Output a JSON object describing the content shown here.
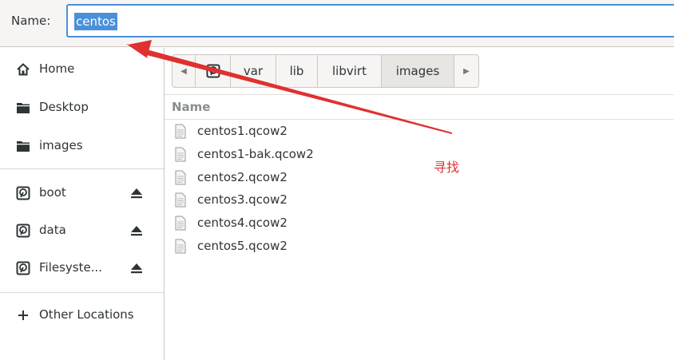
{
  "name_bar": {
    "label": "Name:",
    "value": "centos"
  },
  "sidebar": {
    "places": [
      {
        "label": "Home",
        "icon": "home-icon"
      },
      {
        "label": "Desktop",
        "icon": "folder-icon"
      },
      {
        "label": "images",
        "icon": "folder-icon"
      }
    ],
    "devices": [
      {
        "label": "boot",
        "icon": "drive-icon",
        "eject": true
      },
      {
        "label": "data",
        "icon": "drive-icon",
        "eject": true
      },
      {
        "label": "Filesyste...",
        "icon": "drive-icon",
        "eject": true
      }
    ],
    "other": {
      "label": "Other Locations",
      "icon": "plus-icon"
    }
  },
  "path_bar": {
    "segments": [
      "var",
      "lib",
      "libvirt",
      "images"
    ],
    "active": "images"
  },
  "file_list": {
    "column_header": "Name",
    "files": [
      "centos1.qcow2",
      "centos1-bak.qcow2",
      "centos2.qcow2",
      "centos3.qcow2",
      "centos4.qcow2",
      "centos5.qcow2"
    ]
  },
  "annotation": {
    "text": "寻找",
    "color": "#e03030"
  },
  "colors": {
    "accent": "#4a90d9",
    "annotation": "#e03030"
  }
}
